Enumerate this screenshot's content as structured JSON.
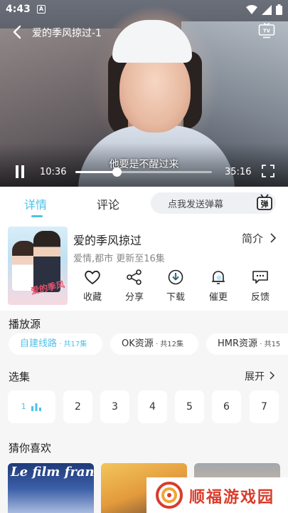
{
  "status_bar": {
    "time": "4:43",
    "notif_letter": "A"
  },
  "player": {
    "title": "爱的季风掠过-1",
    "subtitle": "他要是不醒过来",
    "current_time": "10:36",
    "total_time": "35:16",
    "progress": 0.3
  },
  "tabs": {
    "detail": "详情",
    "comments": "评论"
  },
  "danmaku": {
    "placeholder": "点我发送弹幕",
    "icon_label": "弹"
  },
  "drama": {
    "title": "爱的季风掠过",
    "meta": "爱情,都市 更新至16集",
    "intro_label": "简介",
    "poster_text": "爱的季风"
  },
  "actions": [
    {
      "label": "收藏",
      "icon": "heart-icon"
    },
    {
      "label": "分享",
      "icon": "share-icon"
    },
    {
      "label": "下载",
      "icon": "download-icon"
    },
    {
      "label": "催更",
      "icon": "bell-icon"
    },
    {
      "label": "反馈",
      "icon": "feedback-icon"
    }
  ],
  "sources": {
    "title": "播放源",
    "items": [
      {
        "name": "自建线路",
        "count": " · 共17集"
      },
      {
        "name": "OK资源",
        "count": " · 共12集"
      },
      {
        "name": "HMR资源",
        "count": " · 共15"
      }
    ]
  },
  "episodes": {
    "title": "选集",
    "expand_label": "展开",
    "current_label": "1",
    "items": [
      "2",
      "3",
      "4",
      "5",
      "6",
      "7"
    ]
  },
  "recommend": {
    "title": "猜你喜欢",
    "card1_text": "Le film français"
  },
  "watermark": {
    "text": "顺福游戏园"
  },
  "colors": {
    "accent": "#4fc1e9",
    "text": "#333333",
    "background": "#f6f6f6"
  }
}
